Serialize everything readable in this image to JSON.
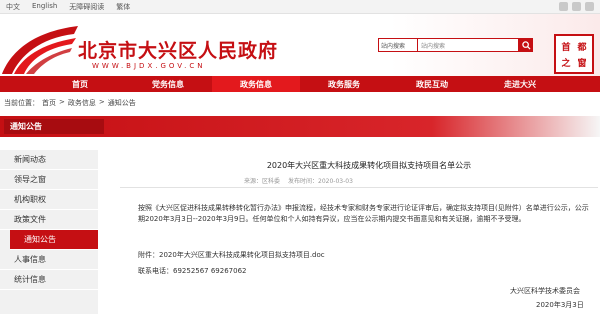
{
  "topbar": {
    "links": [
      "中文",
      "English",
      "无障碍阅读",
      "繁体"
    ]
  },
  "header": {
    "title": "北京市大兴区人民政府",
    "url": "WWW.BJDX.GOV.CN",
    "search_scope": "站内搜索",
    "search_placeholder": "站内搜索",
    "seal": [
      "首",
      "都",
      "之",
      "窗"
    ]
  },
  "nav": {
    "items": [
      "首页",
      "党务信息",
      "政务信息",
      "政务服务",
      "政民互动",
      "走进大兴"
    ],
    "active_index": 2
  },
  "breadcrumb": {
    "prefix": "当前位置：",
    "items": [
      "首页",
      "政务信息",
      "通知公告"
    ],
    "sep": ">"
  },
  "section": {
    "title": "通知公告"
  },
  "sidebar": {
    "items": [
      "新闻动态",
      "领导之窗",
      "机构职权",
      "政策文件",
      "通知公告",
      "人事信息",
      "统计信息"
    ],
    "active_index": 4
  },
  "article": {
    "title": "2020年大兴区重大科技成果转化项目拟支持项目名单公示",
    "source": "来源：区科委",
    "date": "发布时间：2020-03-03",
    "body": "按照《大兴区促进科技成果转移转化暂行办法》申报流程，经技术专家和财务专家进行论证评审后，确定拟支持项目(见附件）名单进行公示，公示期2020年3月3日--2020年3月9日。任何单位和个人如持有异议，应当在公示期内提交书面意见和有关证据，逾期不予受理。",
    "attachment": "附件：2020年大兴区重大科技成果转化项目拟支持项目.doc",
    "phone": "联系电话：69252567 69267062",
    "org": "大兴区科学技术委员会",
    "sign_date": "2020年3月3日"
  },
  "colors": {
    "brand": "#c50f13",
    "nav_active": "#e3191d"
  }
}
